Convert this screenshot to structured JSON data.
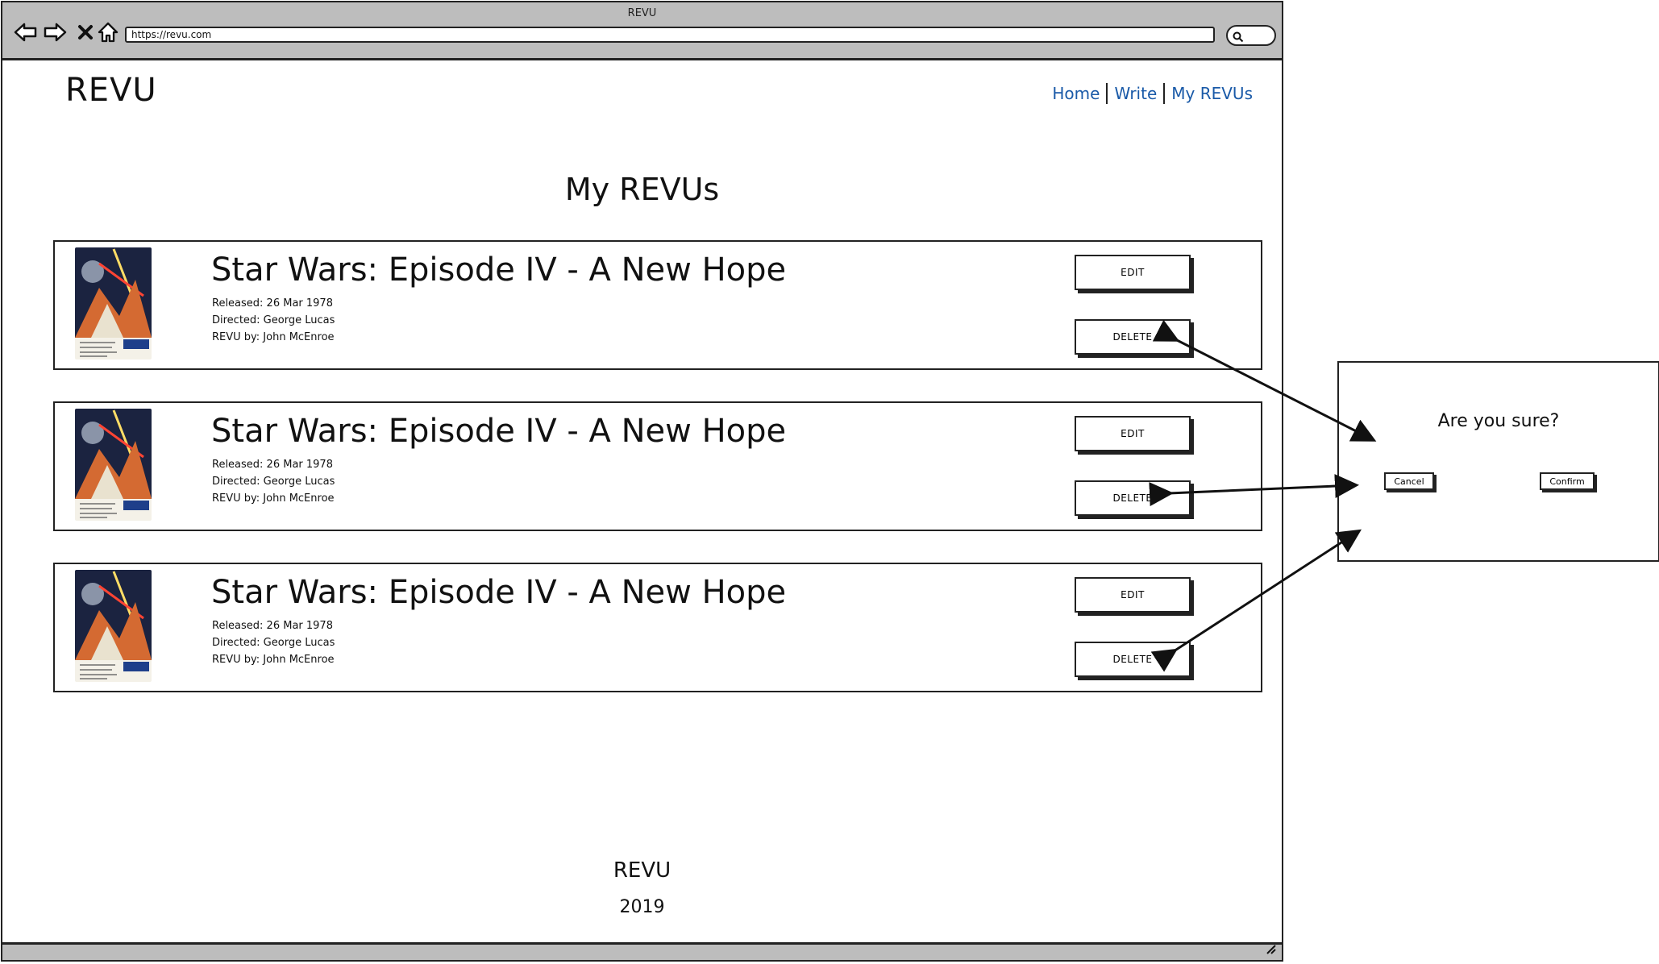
{
  "browser": {
    "window_title": "REVU",
    "url": "https://revu.com",
    "icons": [
      "back-icon",
      "forward-icon",
      "close-icon",
      "home-icon",
      "search-icon"
    ]
  },
  "site": {
    "logo": "REVU",
    "nav": [
      {
        "label": "Home"
      },
      {
        "label": "Write"
      },
      {
        "label": "My REVUs"
      }
    ],
    "page_title": "My REVUs",
    "link_color": "#1a5aa8"
  },
  "reviews": [
    {
      "title": "Star Wars: Episode IV - A New Hope",
      "released": "Released: 26 Mar 1978",
      "directed": "Directed: George Lucas",
      "revu_by": "REVU by: John McEnroe",
      "edit_label": "EDIT",
      "delete_label": "DELETE"
    },
    {
      "title": "Star Wars: Episode IV - A New Hope",
      "released": "Released: 26 Mar 1978",
      "directed": "Directed: George Lucas",
      "revu_by": "REVU by: John McEnroe",
      "edit_label": "EDIT",
      "delete_label": "DELETE"
    },
    {
      "title": "Star Wars: Episode IV - A New Hope",
      "released": "Released: 26 Mar 1978",
      "directed": "Directed: George Lucas",
      "revu_by": "REVU by: John McEnroe",
      "edit_label": "EDIT",
      "delete_label": "DELETE"
    }
  ],
  "footer": {
    "brand": "REVU",
    "year": "2019"
  },
  "modal": {
    "question": "Are you sure?",
    "cancel_label": "Cancel",
    "confirm_label": "Confirm"
  }
}
